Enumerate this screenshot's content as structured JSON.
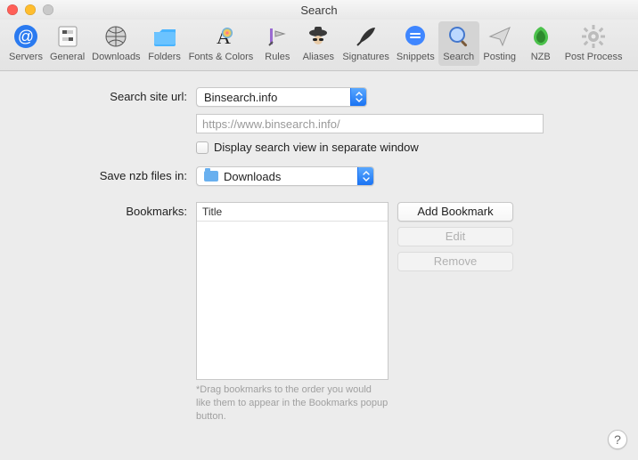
{
  "window": {
    "title": "Search"
  },
  "toolbar": {
    "items": [
      {
        "label": "Servers"
      },
      {
        "label": "General"
      },
      {
        "label": "Downloads"
      },
      {
        "label": "Folders"
      },
      {
        "label": "Fonts & Colors"
      },
      {
        "label": "Rules"
      },
      {
        "label": "Aliases"
      },
      {
        "label": "Signatures"
      },
      {
        "label": "Snippets"
      },
      {
        "label": "Search"
      },
      {
        "label": "Posting"
      },
      {
        "label": "NZB"
      },
      {
        "label": "Post Process"
      }
    ],
    "selected_index": 9
  },
  "form": {
    "search_site_label": "Search site url:",
    "search_site_value": "Binsearch.info",
    "search_url_placeholder": "https://www.binsearch.info/",
    "search_url_value": "",
    "display_separate_label": "Display search view in separate window",
    "display_separate_checked": false,
    "save_nzb_label": "Save nzb files in:",
    "save_nzb_value": "Downloads",
    "bookmarks_label": "Bookmarks:",
    "bookmarks_header": "Title",
    "bookmarks_hint": "*Drag bookmarks to the order you would like them to appear in the Bookmarks popup button.",
    "add_bookmark_label": "Add Bookmark",
    "edit_label": "Edit",
    "remove_label": "Remove"
  },
  "help_glyph": "?"
}
